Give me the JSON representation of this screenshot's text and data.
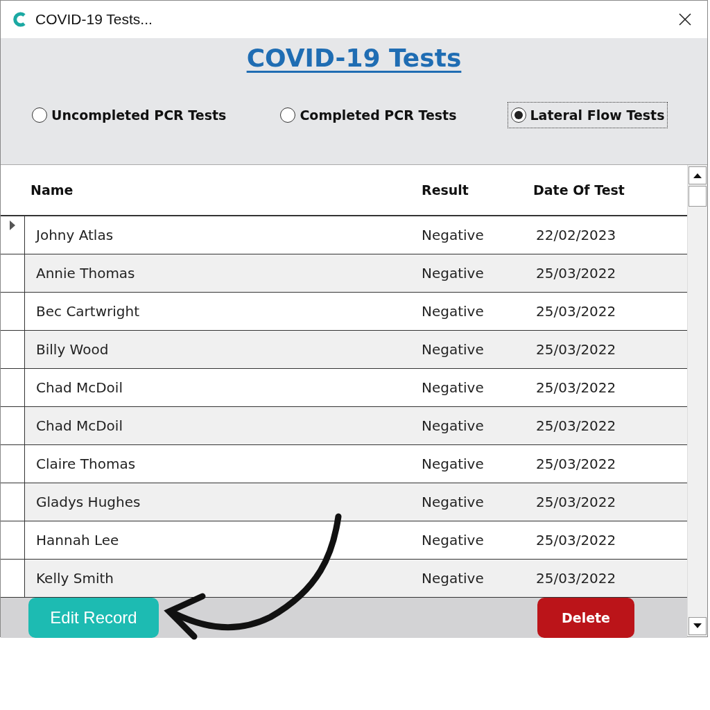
{
  "window": {
    "title": "COVID-19 Tests..."
  },
  "heading": "COVID-19 Tests",
  "filters": [
    {
      "label": "Uncompleted PCR Tests",
      "selected": false
    },
    {
      "label": "Completed PCR Tests",
      "selected": false
    },
    {
      "label": "Lateral Flow Tests",
      "selected": true
    }
  ],
  "table": {
    "columns": [
      "Name",
      "Result",
      "Date Of Test"
    ],
    "rows": [
      {
        "cells": [
          "Johny Atlas",
          "Negative",
          "22/02/2023"
        ],
        "selected": true
      },
      {
        "cells": [
          "Annie Thomas",
          "Negative",
          "25/03/2022"
        ],
        "selected": false
      },
      {
        "cells": [
          "Bec Cartwright",
          "Negative",
          "25/03/2022"
        ],
        "selected": false
      },
      {
        "cells": [
          "Billy Wood",
          "Negative",
          "25/03/2022"
        ],
        "selected": false
      },
      {
        "cells": [
          "Chad McDoil",
          "Negative",
          "25/03/2022"
        ],
        "selected": false
      },
      {
        "cells": [
          "Chad McDoil",
          "Negative",
          "25/03/2022"
        ],
        "selected": false
      },
      {
        "cells": [
          "Claire Thomas",
          "Negative",
          "25/03/2022"
        ],
        "selected": false
      },
      {
        "cells": [
          "Gladys Hughes",
          "Negative",
          "25/03/2022"
        ],
        "selected": false
      },
      {
        "cells": [
          "Hannah Lee",
          "Negative",
          "25/03/2022"
        ],
        "selected": false
      },
      {
        "cells": [
          "Kelly Smith",
          "Negative",
          "25/03/2022"
        ],
        "selected": false
      }
    ]
  },
  "buttons": [
    {
      "label": "Edit Record",
      "kind": "edit"
    },
    {
      "label": "Delete",
      "kind": "delete"
    }
  ]
}
